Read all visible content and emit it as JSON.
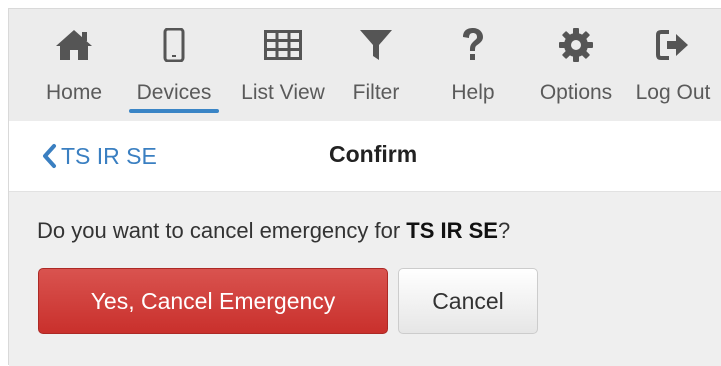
{
  "toolbar": {
    "items": [
      {
        "label": "Home",
        "icon": "home-icon"
      },
      {
        "label": "Devices",
        "icon": "mobile-device-icon"
      },
      {
        "label": "List View",
        "icon": "table-grid-icon"
      },
      {
        "label": "Filter",
        "icon": "filter-funnel-icon"
      },
      {
        "label": "Help",
        "icon": "question-mark-icon"
      },
      {
        "label": "Options",
        "icon": "gear-icon"
      },
      {
        "label": "Log Out",
        "icon": "sign-out-icon"
      }
    ],
    "active_item": "Devices"
  },
  "nav": {
    "back_label": "TS IR SE",
    "title": "Confirm"
  },
  "dialog": {
    "prompt_prefix": "Do you want to cancel emergency for ",
    "device_name": "TS IR SE",
    "prompt_suffix": "?",
    "confirm_label": "Yes, Cancel Emergency",
    "cancel_label": "Cancel"
  },
  "colors": {
    "icon": "#555555",
    "active_underline": "#3a85c6",
    "link": "#3a7fc1",
    "danger_button": "#d9534f",
    "default_button": "#ffffff"
  }
}
